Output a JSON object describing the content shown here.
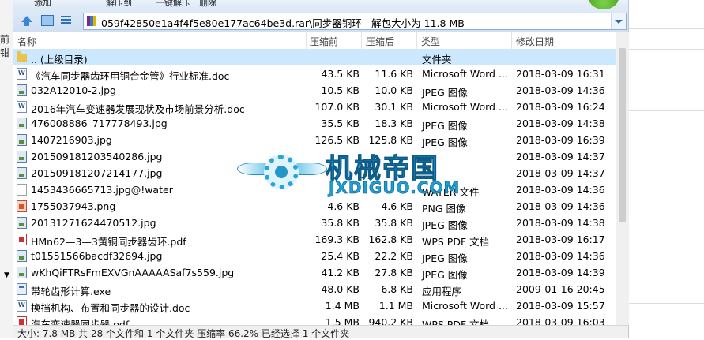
{
  "background": {
    "left_text": "前钳",
    "left_arrow": "▼"
  },
  "toolbar": {
    "items": [
      "添加",
      "解压到",
      "一键解压",
      "删除"
    ]
  },
  "addressbar": {
    "path": "059f42850e1a4f4f5e80e177ac64be3d.rar\\同步器铜环 - 解包大小为 11.8 MB"
  },
  "columns": {
    "name": "名称",
    "size": "压缩前",
    "packed": "压缩后",
    "type": "类型",
    "modified": "修改日期"
  },
  "files": [
    {
      "name": ".. (上级目录)",
      "size": "",
      "packed": "",
      "type": "文件夹",
      "modified": "",
      "icon": "folder-icon"
    },
    {
      "name": "《汽车同步器齿环用铜合金管》行业标准.doc",
      "size": "43.5 KB",
      "packed": "11.6 KB",
      "type": "Microsoft Word ...",
      "modified": "2018-03-09 16:31",
      "icon": "word-doc-icon"
    },
    {
      "name": "032A12010-2.jpg",
      "size": "10.5 KB",
      "packed": "10.0 KB",
      "type": "JPEG 图像",
      "modified": "2018-03-09 14:36",
      "icon": "image-icon"
    },
    {
      "name": "2016年汽车变速器发展现状及市场前景分析.doc",
      "size": "107.0 KB",
      "packed": "30.1 KB",
      "type": "Microsoft Word ...",
      "modified": "2018-03-09 16:24",
      "icon": "word-doc-icon"
    },
    {
      "name": "476008886_717778493.jpg",
      "size": "35.5 KB",
      "packed": "18.3 KB",
      "type": "JPEG 图像",
      "modified": "2018-03-09 14:38",
      "icon": "image-icon"
    },
    {
      "name": "1407216903.jpg",
      "size": "126.5 KB",
      "packed": "125.8 KB",
      "type": "JPEG 图像",
      "modified": "2018-03-09 16:39",
      "icon": "image-icon"
    },
    {
      "name": "201509181203540286.jpg",
      "size": "",
      "packed": "",
      "type": "",
      "modified": "2018-03-09 14:37",
      "icon": "image-icon"
    },
    {
      "name": "201509181207214177.jpg",
      "size": "",
      "packed": "",
      "type": "",
      "modified": "2018-03-09 14:37",
      "icon": "image-icon"
    },
    {
      "name": "1453436665713.jpg@!water",
      "size": "",
      "packed": "",
      "type": "WATER 文件",
      "modified": "2018-03-09 14:36",
      "icon": "file-icon"
    },
    {
      "name": "1755037943.png",
      "size": "4.6 KB",
      "packed": "4.6 KB",
      "type": "PNG 图像",
      "modified": "2018-03-09 14:36",
      "icon": "png-icon"
    },
    {
      "name": "20131271624470512.jpg",
      "size": "35.8 KB",
      "packed": "35.8 KB",
      "type": "JPEG 图像",
      "modified": "2018-03-09 14:38",
      "icon": "image-icon"
    },
    {
      "name": "HMn62—3—3黄铜同步器齿环.pdf",
      "size": "169.3 KB",
      "packed": "162.8 KB",
      "type": "WPS PDF 文档",
      "modified": "2018-03-09 16:17",
      "icon": "pdf-icon"
    },
    {
      "name": "t01551566bacdf32694.jpg",
      "size": "25.4 KB",
      "packed": "22.2 KB",
      "type": "JPEG 图像",
      "modified": "2018-03-09 14:36",
      "icon": "image-icon"
    },
    {
      "name": "wKhQiFTRsFmEXVGnAAAAASaf7s559.jpg",
      "size": "41.2 KB",
      "packed": "27.8 KB",
      "type": "JPEG 图像",
      "modified": "2018-03-09 14:39",
      "icon": "image-icon"
    },
    {
      "name": "带轮齿形计算.exe",
      "size": "48.0 KB",
      "packed": "6.8 KB",
      "type": "应用程序",
      "modified": "2009-01-16 20:45",
      "icon": "exe-icon"
    },
    {
      "name": "换挡机构、布置和同步器的设计.doc",
      "size": "1.4 MB",
      "packed": "1.1 MB",
      "type": "Microsoft Word ...",
      "modified": "2018-03-09 15:57",
      "icon": "word-doc-icon"
    },
    {
      "name": "汽车变速器同步器.pdf",
      "size": "1.5 MB",
      "packed": "940.2 KB",
      "type": "WPS PDF 文档",
      "modified": "2018-03-09 16:03",
      "icon": "pdf-icon"
    }
  ],
  "status": {
    "text": "大小: 7.8 MB 共 28 个文件和 1 个文件夹 压缩率 66.2% 已经选择 1 个文件夹"
  },
  "watermark": {
    "cn": "机械帝国",
    "en": "JXDIGUO.COM",
    "badge": "JX"
  }
}
